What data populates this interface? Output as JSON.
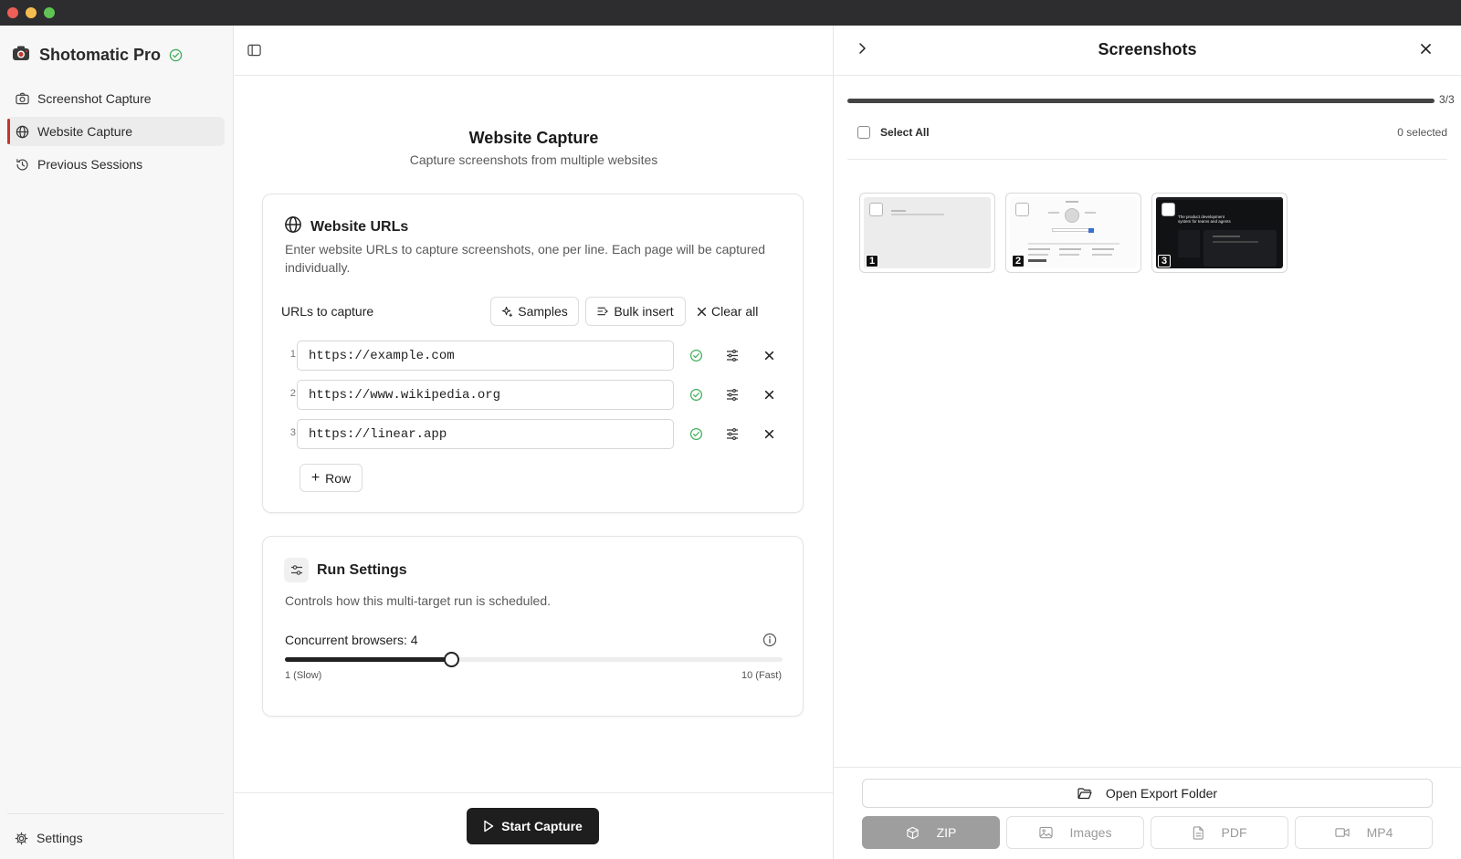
{
  "sidebar": {
    "brand": "Shotomatic Pro",
    "items": [
      {
        "label": "Screenshot Capture",
        "icon": "camera-icon"
      },
      {
        "label": "Website Capture",
        "icon": "globe-icon",
        "active": true
      },
      {
        "label": "Previous Sessions",
        "icon": "history-icon"
      }
    ],
    "settings_label": "Settings"
  },
  "main": {
    "title": "Website Capture",
    "subtitle": "Capture screenshots from multiple websites",
    "urls_card": {
      "heading": "Website URLs",
      "description": "Enter website URLs to capture screenshots, one per line. Each page will be captured individually.",
      "urls_label": "URLs to capture",
      "samples_label": "Samples",
      "bulk_label": "Bulk insert",
      "clear_label": "Clear all",
      "rows": [
        {
          "num": "1",
          "url": "https://example.com"
        },
        {
          "num": "2",
          "url": "https://www.wikipedia.org"
        },
        {
          "num": "3",
          "url": "https://linear.app"
        }
      ],
      "add_row_label": "Row"
    },
    "run_card": {
      "heading": "Run Settings",
      "description": "Controls how this multi-target run is scheduled.",
      "concurrent_label": "Concurrent browsers: 4",
      "slider": {
        "min": 1,
        "max": 10,
        "value": 4
      },
      "min_label": "1 (Slow)",
      "max_label": "10 (Fast)"
    },
    "start_label": "Start Capture"
  },
  "panel": {
    "title": "Screenshots",
    "progress": {
      "done": 3,
      "total": 3
    },
    "progress_text": "3/3",
    "select_all_label": "Select All",
    "selected_text": "0 selected",
    "thumbnails": [
      {
        "num": "1",
        "theme": "light-gray"
      },
      {
        "num": "2",
        "theme": "white"
      },
      {
        "num": "3",
        "theme": "dark",
        "caption": "The product development system for teams and agents"
      }
    ],
    "open_folder_label": "Open Export Folder",
    "formats": [
      {
        "label": "ZIP",
        "icon": "box-icon",
        "active": true
      },
      {
        "label": "Images",
        "icon": "image-icon"
      },
      {
        "label": "PDF",
        "icon": "file-icon"
      },
      {
        "label": "MP4",
        "icon": "video-icon"
      }
    ]
  },
  "colors": {
    "accent": "#c0392b",
    "success": "#3fae5a",
    "dark_button": "#1e1e1e"
  }
}
